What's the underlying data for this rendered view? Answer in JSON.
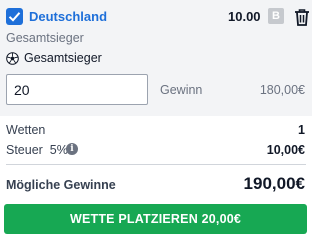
{
  "bet": {
    "selection": "Deutschland",
    "odds": "10.00",
    "badge": "B",
    "market": "Gesamtsieger",
    "event": "Gesamtsieger",
    "stake": "20",
    "gewinn_label": "Gewinn",
    "gewinn_value": "180,00€",
    "checked": true
  },
  "summary": {
    "wetten_label": "Wetten",
    "wetten_value": "1",
    "steuer_label": "Steuer  5%",
    "steuer_value": "10,00€",
    "moegliche_label": "Mögliche Gewinne",
    "moegliche_value": "190,00€"
  },
  "action": {
    "place_label": "WETTE PLATZIEREN 20,00€"
  },
  "icons": {
    "checkbox": "checkbox-checked-icon",
    "trash": "trash-icon",
    "event": "soccer-ball-icon",
    "info": "info-icon"
  },
  "colors": {
    "accent": "#1e6fd9",
    "button": "#17a853",
    "panel": "#f3f4f6"
  }
}
